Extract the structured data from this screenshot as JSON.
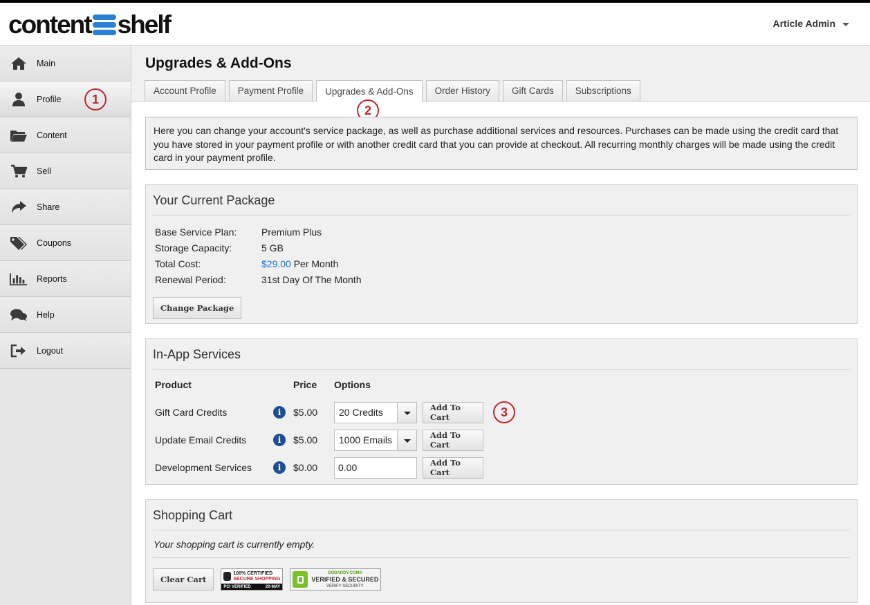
{
  "logo": {
    "left": "content",
    "right": "shelf"
  },
  "user_menu": {
    "label": "Article Admin"
  },
  "sidebar": {
    "items": [
      {
        "label": "Main",
        "icon": "home-icon"
      },
      {
        "label": "Profile",
        "icon": "user-icon"
      },
      {
        "label": "Content",
        "icon": "folder-icon"
      },
      {
        "label": "Sell",
        "icon": "cart-icon"
      },
      {
        "label": "Share",
        "icon": "share-icon"
      },
      {
        "label": "Coupons",
        "icon": "tags-icon"
      },
      {
        "label": "Reports",
        "icon": "bar-chart-icon"
      },
      {
        "label": "Help",
        "icon": "chat-icon"
      },
      {
        "label": "Logout",
        "icon": "logout-icon"
      }
    ]
  },
  "callouts": {
    "one": "1",
    "two": "2",
    "three": "3"
  },
  "page": {
    "title": "Upgrades & Add-Ons",
    "tabs": [
      {
        "label": "Account Profile"
      },
      {
        "label": "Payment Profile"
      },
      {
        "label": "Upgrades & Add-Ons"
      },
      {
        "label": "Order History"
      },
      {
        "label": "Gift Cards"
      },
      {
        "label": "Subscriptions"
      }
    ],
    "intro": "Here you can change your account's service package, as well as purchase additional services and resources. Purchases can be made using the credit card that you have stored in your payment profile or with another credit card that you can provide at checkout. All recurring monthly charges will be made using the credit card in your payment profile."
  },
  "current_package": {
    "heading": "Your Current Package",
    "base_plan_label": "Base Service Plan:",
    "base_plan_value": "Premium Plus",
    "storage_label": "Storage Capacity:",
    "storage_value": "5 GB",
    "cost_label": "Total Cost:",
    "cost_amount": "$29.00",
    "cost_suffix": "Per Month",
    "renewal_label": "Renewal Period:",
    "renewal_value": "31st Day Of The Month",
    "change_button": "Change Package"
  },
  "services": {
    "heading": "In-App Services",
    "col_product": "Product",
    "col_price": "Price",
    "col_options": "Options",
    "rows": [
      {
        "product": "Gift Card Credits",
        "price": "$5.00",
        "option": "20 Credits",
        "button": "Add To Cart"
      },
      {
        "product": "Update Email Credits",
        "price": "$5.00",
        "option": "1000 Emails",
        "button": "Add To Cart"
      },
      {
        "product": "Development Services",
        "price": "$0.00",
        "option": "0.00",
        "button": "Add To Cart"
      }
    ]
  },
  "cart": {
    "heading": "Shopping Cart",
    "empty_text": "Your shopping cart is currently empty.",
    "clear_button": "Clear Cart",
    "badge_certified": {
      "line1": "100% CERTIFIED",
      "line2": "SECURE SHOPPING",
      "foot_left": "PCI VERIFIED",
      "foot_right": "20-MAY"
    },
    "badge_godaddy": {
      "line1": "GODADDY.COM®",
      "line2": "VERIFIED & SECURED",
      "line3": "VERIFY SECURITY"
    }
  },
  "colors": {
    "accent_link": "#1f6fc0",
    "callout": "#c0282d",
    "logo_blue": "#2a7fd4"
  }
}
